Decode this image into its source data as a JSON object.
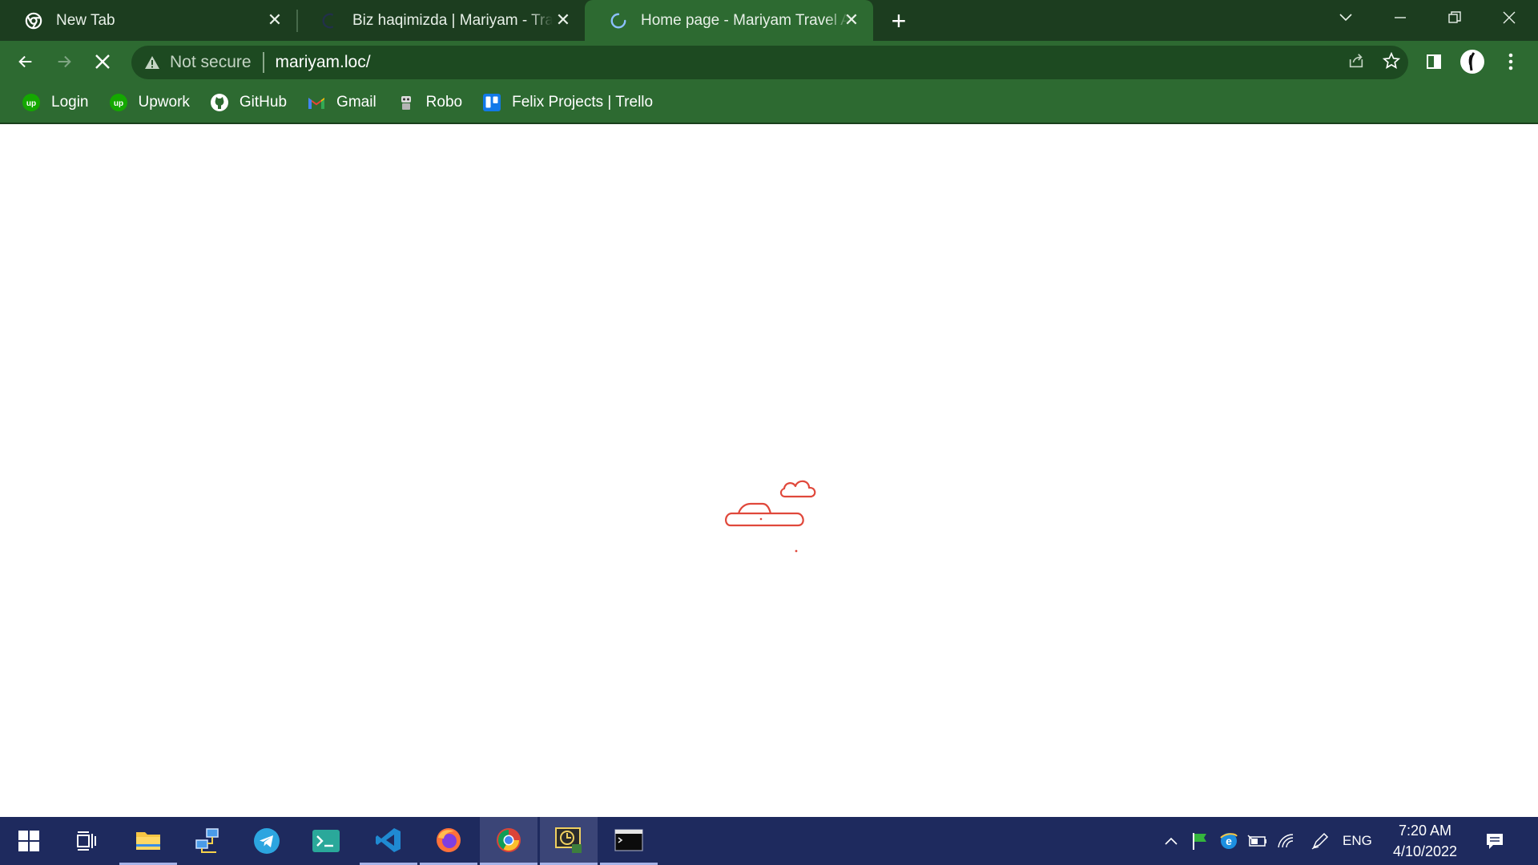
{
  "browser": {
    "tabs": [
      {
        "title": "New Tab",
        "favicon": "chrome-icon",
        "active": false
      },
      {
        "title": "Biz haqimizda | Mariyam - Travel",
        "favicon": "site-icon",
        "active": false
      },
      {
        "title": "Home page - Mariyam Travel Agency",
        "favicon": "loading-spinner-icon",
        "active": true
      }
    ],
    "new_tab_label": "+",
    "address_bar": {
      "security_label": "Not secure",
      "url": "mariyam.loc/"
    },
    "bookmarks": [
      {
        "label": "Login",
        "icon": "upwork-icon"
      },
      {
        "label": "Upwork",
        "icon": "upwork-icon"
      },
      {
        "label": "GitHub",
        "icon": "github-icon"
      },
      {
        "label": "Gmail",
        "icon": "gmail-icon"
      },
      {
        "label": "Robo",
        "icon": "robot-icon"
      },
      {
        "label": "Felix Projects | Trello",
        "icon": "trello-icon"
      }
    ]
  },
  "page": {
    "state": "loading",
    "loader_icon": "airplane-clouds-loader",
    "loader_color": "#e0483b"
  },
  "taskbar": {
    "apps": [
      {
        "name": "start",
        "icon": "windows-icon"
      },
      {
        "name": "task-view",
        "icon": "task-view-icon"
      },
      {
        "name": "file-explorer",
        "icon": "folder-icon"
      },
      {
        "name": "network",
        "icon": "network-icon"
      },
      {
        "name": "telegram",
        "icon": "telegram-icon"
      },
      {
        "name": "terminal",
        "icon": "terminal-icon"
      },
      {
        "name": "vscode",
        "icon": "vscode-icon"
      },
      {
        "name": "firefox",
        "icon": "firefox-icon"
      },
      {
        "name": "chrome",
        "icon": "chrome-icon"
      },
      {
        "name": "monitor",
        "icon": "monitor-icon"
      },
      {
        "name": "console",
        "icon": "console-icon"
      }
    ],
    "language": "ENG",
    "time": "7:20 AM",
    "date": "4/10/2022"
  },
  "colors": {
    "tab_strip": "#1c3d1f",
    "toolbar": "#2d6a31",
    "taskbar": "#1e2a5e",
    "accent_red": "#e0483b"
  }
}
